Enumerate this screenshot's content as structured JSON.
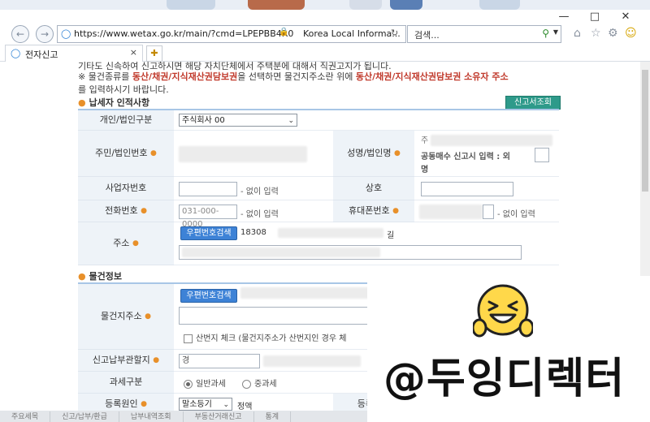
{
  "browser": {
    "url": "https://www.wetax.go.kr/main/?cmd=LPEPBB4R0",
    "site_name": "Korea Local Informa...",
    "search_placeholder": "검색...",
    "tab_title": "전자신고",
    "tab_close": "×"
  },
  "notice": {
    "line1": "기타도 신속하여 신고하시면 해당 자치단체에서 주택분에 대해서 직권고지가 됩니다.",
    "line2_pre": "※ 물건종류를 ",
    "line2_red1": "동산/채권/지식재산권담보권",
    "line2_mid": "을 선택하면 물건지주소란 위에 ",
    "line2_red2": "동산/채권/지식재산권담보권 소유자 주소",
    "line3": "를 입력하시기 바랍니다."
  },
  "taxpayer": {
    "section_title": "납세자 인적사항",
    "lookup_button": "신고서조회",
    "type_label": "개인/법인구분",
    "type_value": "주식회사 00",
    "id_label": "주민/법인번호",
    "name_label": "성명/법인명",
    "name_partial": "주",
    "joint_note": "공동매수 신고시 입력 : 외",
    "joint_note2": "명",
    "biz_label": "사업자번호",
    "biz_hint": "- 없이 입력",
    "company_label": "상호",
    "phone_label": "전화번호",
    "phone_value": "031-000-0000",
    "phone_hint": "- 없이 입력",
    "mobile_label": "휴대폰번호",
    "mobile_hint": "- 없이 입력",
    "address_label": "주소",
    "zip_button": "우편번호검색",
    "zip_value": "18308",
    "address_suffix": "길"
  },
  "property": {
    "section_title": "물건정보",
    "zip_button": "우편번호검색",
    "address_label": "물건지주소",
    "mountain_check": "산번지 체크 (물건지주소가 산번지인 경우 체",
    "office_label": "신고납부관할지",
    "office_partial": "경",
    "tax_type_label": "과세구분",
    "tax_general": "일반과세",
    "tax_heavy": "중과세",
    "reg_cause_label": "등록원인",
    "reg_cause_value": "말소등기",
    "reg_cause_suffix": "정액",
    "reg_item_label": "등록물건"
  },
  "bottom_tabs": [
    "주요세목",
    "신고/납부/환급",
    "납부내역조회",
    "부동산거래신고",
    "통계"
  ],
  "watermark": {
    "handle": "@두잉디렉터"
  }
}
